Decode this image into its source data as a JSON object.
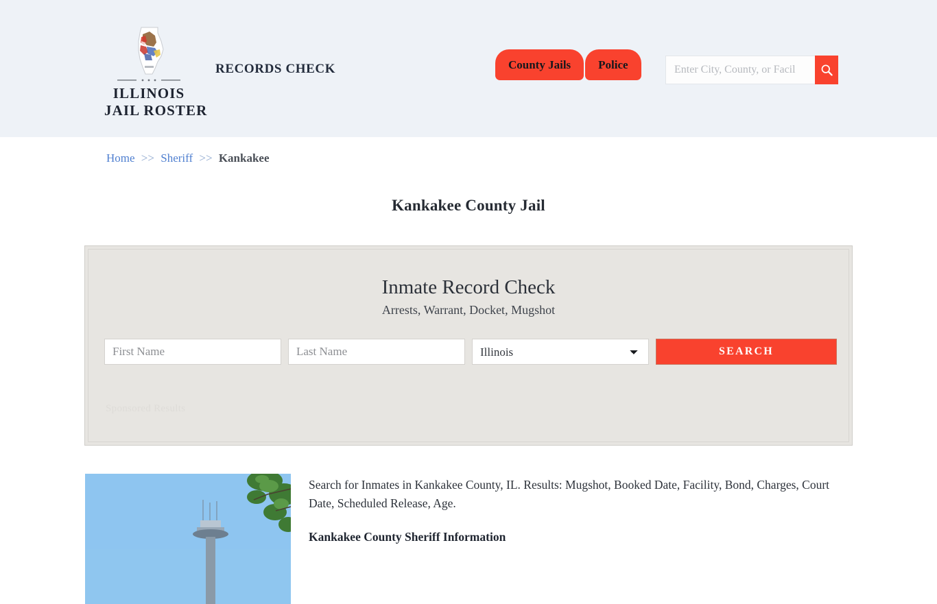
{
  "header": {
    "brand": {
      "logo_icon": "illinois-state-outline-icon",
      "name_line1": "ILLINOIS",
      "name_line2": "JAIL ROSTER"
    },
    "tagline": "RECORDS CHECK",
    "nav": [
      {
        "label": "County Jails"
      },
      {
        "label": "Police"
      }
    ],
    "search": {
      "placeholder": "Enter City, County, or Facil",
      "value": "",
      "button_icon": "search-icon"
    },
    "background_color": "#eef2f7",
    "accent_color": "#f9422e"
  },
  "breadcrumb": {
    "items": [
      {
        "label": "Home",
        "type": "link"
      },
      {
        "label": "Sheriff",
        "type": "link"
      },
      {
        "label": "Kankakee",
        "type": "current"
      }
    ],
    "separator": ">>"
  },
  "page": {
    "title": "Kankakee County Jail"
  },
  "sponsor_card": {
    "heading": "Inmate Record Check",
    "subheading": "Arrests, Warrant, Docket, Mugshot",
    "form": {
      "first_name_placeholder": "First Name",
      "first_name_value": "",
      "last_name_placeholder": "Last Name",
      "last_name_value": "",
      "state_selected": "Illinois",
      "state_options": [
        "Illinois"
      ],
      "search_button": "SEARCH"
    },
    "sponsored_label": "Sponsored Results",
    "background_color": "#e7e5e1"
  },
  "content": {
    "thumbnail_alt": "kankakee-county-jail-photo",
    "paragraph": "Search for Inmates in Kankakee County, IL. Results: Mugshot, Booked Date, Facility, Bond, Charges, Court Date, Scheduled Release, Age.",
    "subheading": "Kankakee County Sheriff Information"
  }
}
